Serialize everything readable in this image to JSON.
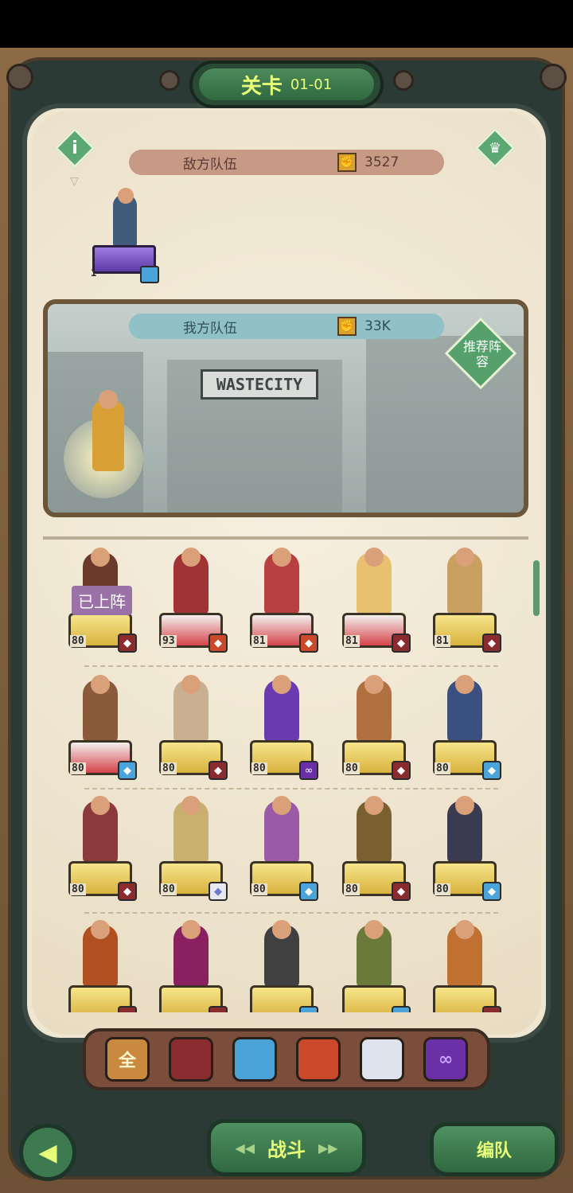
{
  "stage": {
    "title": "关卡",
    "level": "01-01"
  },
  "enemy": {
    "label": "敌方队伍",
    "power": "3527",
    "units": [
      {
        "level": "1",
        "faction": "tide"
      }
    ]
  },
  "ally": {
    "label": "我方队伍",
    "power": "33K",
    "recommend": "推荐阵容",
    "background_sign": "WASTECITY"
  },
  "deployed_tag": "已上阵",
  "heroes": [
    {
      "level": "80",
      "base": "gold",
      "faction": "red",
      "deployed": true
    },
    {
      "level": "93",
      "base": "red",
      "faction": "orange",
      "deployed": false
    },
    {
      "level": "81",
      "base": "red",
      "faction": "orange",
      "deployed": false
    },
    {
      "level": "81",
      "base": "red",
      "faction": "red",
      "deployed": false
    },
    {
      "level": "81",
      "base": "gold",
      "faction": "red",
      "deployed": false
    },
    {
      "level": "80",
      "base": "red",
      "faction": "blue",
      "deployed": false
    },
    {
      "level": "80",
      "base": "gold",
      "faction": "red",
      "deployed": false
    },
    {
      "level": "80",
      "base": "gold",
      "faction": "purple",
      "deployed": false
    },
    {
      "level": "80",
      "base": "gold",
      "faction": "red",
      "deployed": false
    },
    {
      "level": "80",
      "base": "gold",
      "faction": "blue",
      "deployed": false
    },
    {
      "level": "80",
      "base": "gold",
      "faction": "red",
      "deployed": false
    },
    {
      "level": "80",
      "base": "gold",
      "faction": "white",
      "deployed": false
    },
    {
      "level": "80",
      "base": "gold",
      "faction": "blue",
      "deployed": false
    },
    {
      "level": "80",
      "base": "gold",
      "faction": "red",
      "deployed": false
    },
    {
      "level": "80",
      "base": "gold",
      "faction": "blue",
      "deployed": false
    },
    {
      "level": "",
      "base": "gold",
      "faction": "red",
      "deployed": false
    },
    {
      "level": "",
      "base": "gold",
      "faction": "red",
      "deployed": false
    },
    {
      "level": "",
      "base": "gold",
      "faction": "blue",
      "deployed": false
    },
    {
      "level": "",
      "base": "gold",
      "faction": "blue",
      "deployed": false
    },
    {
      "level": "",
      "base": "gold",
      "faction": "red",
      "deployed": false
    }
  ],
  "filters": [
    {
      "label": "全",
      "name": "all"
    },
    {
      "label": "",
      "name": "red"
    },
    {
      "label": "",
      "name": "blue"
    },
    {
      "label": "",
      "name": "orange"
    },
    {
      "label": "",
      "name": "white"
    },
    {
      "label": "∞",
      "name": "purple"
    }
  ],
  "buttons": {
    "back": "◀",
    "fight": "战斗",
    "team": "编队"
  },
  "colors": {
    "accent_text": "#e8ff7a",
    "button_green": "#3d7a4f",
    "panel": "#efe6d2"
  }
}
